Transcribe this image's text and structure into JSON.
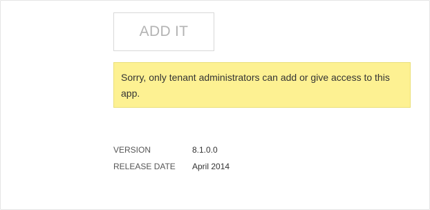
{
  "action": {
    "add_label": "ADD IT"
  },
  "notice": {
    "message": "Sorry, only tenant administrators can add or give access to this app."
  },
  "details": [
    {
      "label": "VERSION",
      "value": "8.1.0.0"
    },
    {
      "label": "RELEASE DATE",
      "value": "April 2014"
    }
  ],
  "colors": {
    "notice_background": "#fdf192",
    "button_text_disabled": "#b3b3b3"
  }
}
